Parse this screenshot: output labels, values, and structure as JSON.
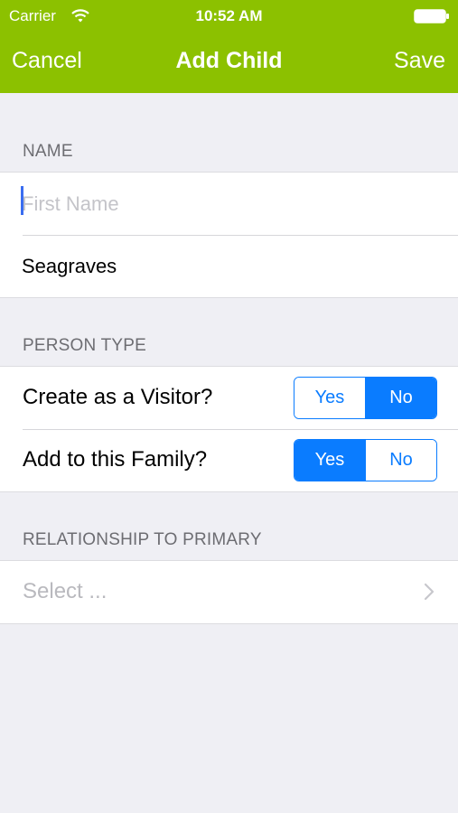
{
  "status_bar": {
    "carrier": "Carrier",
    "time": "10:52 AM"
  },
  "nav": {
    "cancel_label": "Cancel",
    "title": "Add Child",
    "save_label": "Save"
  },
  "name_section": {
    "header": "NAME",
    "first_name": {
      "value": "",
      "placeholder": "First Name"
    },
    "last_name": {
      "value": "Seagraves"
    }
  },
  "person_type_section": {
    "header": "PERSON TYPE",
    "visitor": {
      "label": "Create as a Visitor?",
      "yes_label": "Yes",
      "no_label": "No",
      "selected": "No"
    },
    "family": {
      "label": "Add to this Family?",
      "yes_label": "Yes",
      "no_label": "No",
      "selected": "Yes"
    }
  },
  "relationship_section": {
    "header": "RELATIONSHIP TO PRIMARY",
    "select_placeholder": "Select ..."
  },
  "colors": {
    "nav_background": "#8cc100",
    "segment_accent": "#0a7cff",
    "page_background": "#efeff4"
  }
}
